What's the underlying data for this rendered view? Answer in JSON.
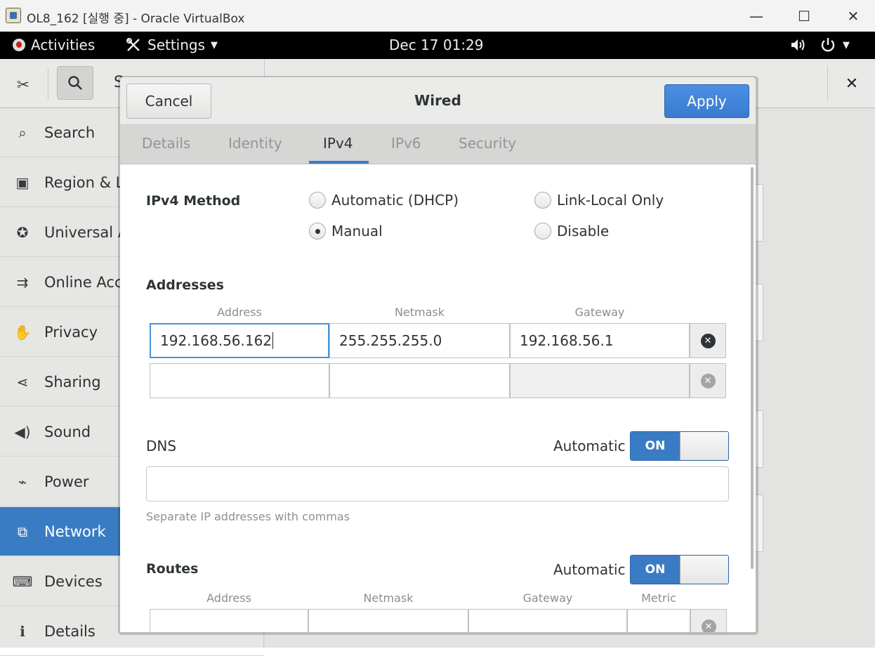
{
  "window": {
    "title": "OL8_162 [실행 중] - Oracle VirtualBox",
    "minimize_icon": "—",
    "maximize_icon": "☐",
    "close_icon": "✕"
  },
  "topbar": {
    "activities": "Activities",
    "app_menu": "Settings",
    "clock": "Dec 17  01:29"
  },
  "settings": {
    "header_partial": "S",
    "sidebar": [
      {
        "label": "Search",
        "icon": "search-icon"
      },
      {
        "label": "Region & L",
        "icon": "region-icon"
      },
      {
        "label": "Universal A",
        "icon": "accessibility-icon"
      },
      {
        "label": "Online Acc",
        "icon": "online-accounts-icon"
      },
      {
        "label": "Privacy",
        "icon": "privacy-icon"
      },
      {
        "label": "Sharing",
        "icon": "sharing-icon"
      },
      {
        "label": "Sound",
        "icon": "sound-icon"
      },
      {
        "label": "Power",
        "icon": "power-icon"
      },
      {
        "label": "Network",
        "icon": "network-icon",
        "active": true
      },
      {
        "label": "Devices",
        "icon": "devices-icon"
      },
      {
        "label": "Details",
        "icon": "details-icon"
      }
    ]
  },
  "dialog": {
    "cancel": "Cancel",
    "title": "Wired",
    "apply": "Apply",
    "tabs": [
      "Details",
      "Identity",
      "IPv4",
      "IPv6",
      "Security"
    ],
    "active_tab": "IPv4",
    "ipv4_method_label": "IPv4 Method",
    "methods": {
      "automatic": "Automatic (DHCP)",
      "link_local": "Link-Local Only",
      "manual": "Manual",
      "disable": "Disable"
    },
    "selected_method": "Manual",
    "addresses_label": "Addresses",
    "address_columns": [
      "Address",
      "Netmask",
      "Gateway"
    ],
    "address_rows": [
      {
        "address": "192.168.56.162",
        "netmask": "255.255.255.0",
        "gateway": "192.168.56.1"
      },
      {
        "address": "",
        "netmask": "",
        "gateway": ""
      }
    ],
    "dns_label": "DNS",
    "automatic_label": "Automatic",
    "switch_on": "ON",
    "dns_value": "",
    "dns_hint": "Separate IP addresses with commas",
    "routes_label": "Routes",
    "route_columns": [
      "Address",
      "Netmask",
      "Gateway",
      "Metric"
    ]
  },
  "colors": {
    "accent": "#3a7cc4",
    "apply": "#4a90e2",
    "topbar": "#000000"
  }
}
